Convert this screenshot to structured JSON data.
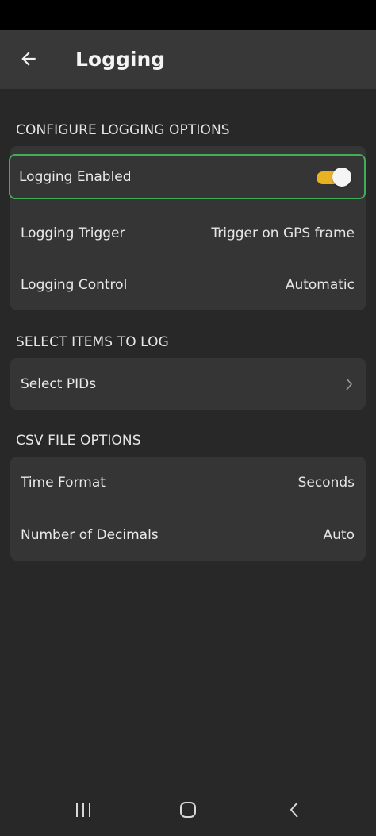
{
  "app_bar": {
    "title": "Logging",
    "back_icon": "arrow-left-icon"
  },
  "sections": {
    "configure": {
      "header": "CONFIGURE LOGGING OPTIONS",
      "logging_enabled": {
        "label": "Logging Enabled",
        "enabled": true
      },
      "logging_trigger": {
        "label": "Logging Trigger",
        "value": "Trigger on GPS frame"
      },
      "logging_control": {
        "label": "Logging Control",
        "value": "Automatic"
      }
    },
    "select_items": {
      "header": "SELECT ITEMS TO LOG",
      "select_pids": {
        "label": "Select PIDs",
        "icon": "chevron-right-icon"
      }
    },
    "csv": {
      "header": "CSV FILE OPTIONS",
      "time_format": {
        "label": "Time Format",
        "value": "Seconds"
      },
      "decimals": {
        "label": "Number of Decimals",
        "value": "Auto"
      }
    }
  },
  "colors": {
    "background": "#282828",
    "app_bar": "#383838",
    "card": "#353535",
    "toggle_track": "#e8b320",
    "highlight_border": "#3fae54"
  },
  "nav_bar": {
    "recents_icon": "recents-icon",
    "home_icon": "home-icon",
    "back_icon": "chevron-left-icon"
  }
}
